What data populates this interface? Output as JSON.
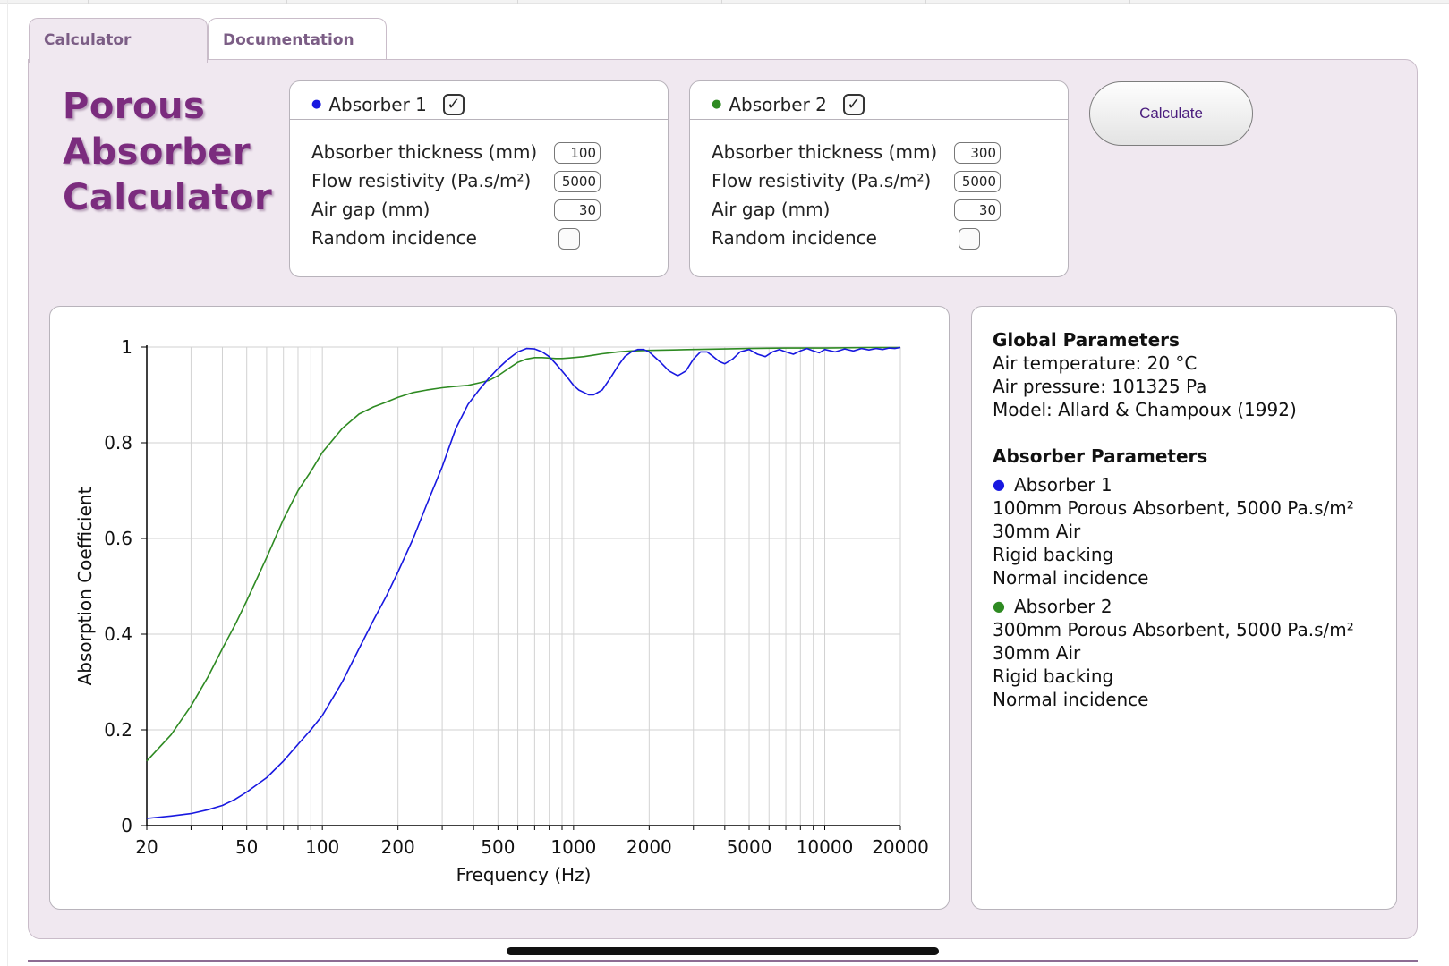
{
  "tabs": [
    {
      "label": "Calculator",
      "active": true
    },
    {
      "label": "Documentation",
      "active": false
    }
  ],
  "app_title": [
    "Porous",
    "Absorber",
    "Calculator"
  ],
  "absorbers": [
    {
      "name": "Absorber 1",
      "color": "#1818e0",
      "enabled": true,
      "fields": {
        "thickness_label": "Absorber thickness (mm)",
        "thickness_value": "100",
        "flow_label": "Flow resistivity (Pa.s/m²)",
        "flow_value": "5000",
        "airgap_label": "Air gap (mm)",
        "airgap_value": "30",
        "random_label": "Random incidence",
        "random_checked": false
      }
    },
    {
      "name": "Absorber 2",
      "color": "#2e8a22",
      "enabled": true,
      "fields": {
        "thickness_label": "Absorber thickness (mm)",
        "thickness_value": "300",
        "flow_label": "Flow resistivity (Pa.s/m²)",
        "flow_value": "5000",
        "airgap_label": "Air gap (mm)",
        "airgap_value": "30",
        "random_label": "Random incidence",
        "random_checked": false
      }
    }
  ],
  "calculate_label": "Calculate",
  "info": {
    "global_heading": "Global Parameters",
    "global_lines": [
      "Air temperature: 20 °C",
      "Air pressure: 101325 Pa",
      "Model: Allard & Champoux (1992)"
    ],
    "absorber_heading": "Absorber Parameters",
    "absorbers": [
      {
        "name": "Absorber 1",
        "lines": [
          "100mm Porous Absorbent, 5000 Pa.s/m²",
          "30mm Air",
          "Rigid backing",
          "Normal incidence"
        ]
      },
      {
        "name": "Absorber 2",
        "lines": [
          "300mm Porous Absorbent, 5000 Pa.s/m²",
          "30mm Air",
          "Rigid backing",
          "Normal incidence"
        ]
      }
    ]
  },
  "chart_data": {
    "type": "line",
    "xlabel": "Frequency (Hz)",
    "ylabel": "Absorption Coefficient",
    "x_scale": "log",
    "xlim": [
      20,
      20000
    ],
    "ylim": [
      0,
      1
    ],
    "x_ticks": [
      20,
      50,
      100,
      200,
      500,
      1000,
      2000,
      5000,
      10000,
      20000
    ],
    "y_ticks": [
      0,
      0.2,
      0.4,
      0.6,
      0.8,
      1
    ],
    "y_tick_labels": [
      "0",
      "0.2",
      "0.4",
      "0.6",
      "0.8",
      "1"
    ],
    "grid": true,
    "series": [
      {
        "name": "Absorber 1",
        "color": "#1818e0",
        "x": [
          20,
          25,
          30,
          35,
          40,
          45,
          50,
          60,
          70,
          80,
          90,
          100,
          120,
          140,
          160,
          180,
          200,
          230,
          260,
          300,
          340,
          380,
          420,
          460,
          500,
          550,
          600,
          650,
          700,
          750,
          800,
          850,
          900,
          950,
          1000,
          1050,
          1100,
          1150,
          1200,
          1300,
          1400,
          1500,
          1600,
          1700,
          1800,
          1900,
          2000,
          2200,
          2400,
          2600,
          2800,
          3000,
          3200,
          3400,
          3600,
          3800,
          4000,
          4300,
          4600,
          5000,
          5400,
          5800,
          6200,
          6600,
          7000,
          7500,
          8000,
          8500,
          9000,
          9500,
          10000,
          11000,
          12000,
          13000,
          14000,
          15000,
          16000,
          17000,
          18000,
          19000,
          20000
        ],
        "values": [
          0.015,
          0.02,
          0.025,
          0.033,
          0.042,
          0.055,
          0.07,
          0.1,
          0.135,
          0.17,
          0.2,
          0.23,
          0.3,
          0.37,
          0.43,
          0.48,
          0.53,
          0.6,
          0.67,
          0.75,
          0.83,
          0.88,
          0.91,
          0.935,
          0.955,
          0.975,
          0.99,
          0.997,
          0.996,
          0.99,
          0.98,
          0.965,
          0.95,
          0.935,
          0.92,
          0.91,
          0.905,
          0.9,
          0.9,
          0.91,
          0.935,
          0.96,
          0.98,
          0.99,
          0.995,
          0.995,
          0.99,
          0.97,
          0.95,
          0.94,
          0.95,
          0.975,
          0.99,
          0.99,
          0.98,
          0.97,
          0.965,
          0.975,
          0.99,
          0.995,
          0.985,
          0.98,
          0.99,
          0.995,
          0.99,
          0.985,
          0.992,
          0.997,
          0.992,
          0.988,
          0.995,
          0.99,
          0.996,
          0.992,
          0.997,
          0.994,
          0.997,
          0.995,
          0.998,
          0.997,
          0.999
        ]
      },
      {
        "name": "Absorber 2",
        "color": "#2e8a22",
        "x": [
          20,
          25,
          30,
          35,
          40,
          45,
          50,
          60,
          70,
          80,
          90,
          100,
          120,
          140,
          160,
          180,
          200,
          230,
          260,
          300,
          340,
          380,
          420,
          460,
          500,
          550,
          600,
          650,
          700,
          750,
          800,
          850,
          900,
          950,
          1000,
          1100,
          1200,
          1300,
          1400,
          1500,
          1700,
          2000,
          2500,
          3000,
          4000,
          5000,
          7000,
          10000,
          15000,
          20000
        ],
        "values": [
          0.135,
          0.19,
          0.25,
          0.31,
          0.37,
          0.42,
          0.47,
          0.56,
          0.64,
          0.7,
          0.74,
          0.78,
          0.83,
          0.86,
          0.875,
          0.885,
          0.895,
          0.905,
          0.91,
          0.915,
          0.918,
          0.92,
          0.925,
          0.93,
          0.94,
          0.955,
          0.968,
          0.975,
          0.978,
          0.978,
          0.977,
          0.976,
          0.976,
          0.977,
          0.978,
          0.98,
          0.983,
          0.986,
          0.988,
          0.99,
          0.992,
          0.993,
          0.994,
          0.995,
          0.996,
          0.997,
          0.998,
          0.998,
          0.999,
          0.999
        ]
      }
    ]
  }
}
